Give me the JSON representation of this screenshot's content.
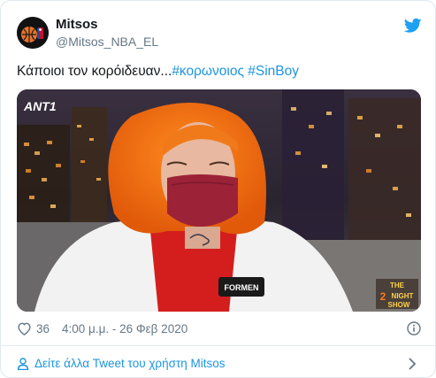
{
  "author": {
    "name": "Mitsos",
    "handle": "@Mitsos_NBA_EL"
  },
  "tweet": {
    "text": "Κάποιοι τον κορόιδευαν...",
    "hashtags": [
      "#κορωνοιος",
      "#SinBoy"
    ]
  },
  "media": {
    "channel_logo": "ANT1",
    "show_logo": [
      "THE",
      "2",
      "NIGHT",
      "SHOW"
    ],
    "jacket_patch": "FORMEN"
  },
  "meta": {
    "likes": "36",
    "timestamp": "4:00 μ.μ. - 26 Φεβ 2020"
  },
  "footer": {
    "more_tweets": "Δείτε άλλα Tweet του χρήστη Mitsos"
  },
  "icons": {
    "brand": "twitter-bird-icon",
    "like": "heart-icon",
    "info": "info-icon",
    "profile": "person-icon",
    "next": "chevron-right-icon"
  },
  "colors": {
    "link": "#1b95e0",
    "secondary_text": "#657786",
    "twitter_blue": "#1da1f2",
    "border": "#e1e8ed"
  }
}
